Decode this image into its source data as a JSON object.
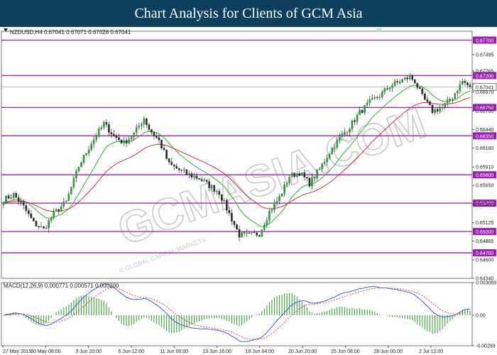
{
  "banner": {
    "title": "Chart Analysis for Clients of GCM Asia"
  },
  "watermark": {
    "text": "GCMASIA.COM",
    "subtext": "© GLOBAL CAPITAL MARKETS"
  },
  "colors": {
    "banner": "#0d3f5f",
    "bull": "#2a9a3a",
    "bear": "#2a2a2a",
    "level": "#9b1fb3",
    "ma_fast": "#22a322",
    "ma_slow": "#d01e2e",
    "macd_line": "#2a4ed8",
    "macd_signal": "#e03030",
    "histogram": "#3ca23c",
    "current_price": "#222222"
  },
  "chart_data": [
    {
      "type": "candlestick",
      "header": "NZDUSD,H4  0.67041 0.67071 0.67028 0.67041",
      "symbol": "NZDUSD",
      "timeframe": "H4",
      "ohlc": {
        "open": 0.67041,
        "high": 0.67071,
        "low": 0.67028,
        "close": 0.67041
      },
      "ylim": [
        0.6434,
        0.67825
      ],
      "y_ticks": [
        0.67265,
        0.67495,
        0.6697,
        0.667,
        0.6644,
        0.6618,
        0.6591,
        0.6565,
        0.6538,
        0.65125,
        0.64865,
        0.646,
        0.6434
      ],
      "x_ticks": [
        "27 May 2019",
        "30 May 08:00",
        "3 Jun 20:00",
        "6 Jun 12:00",
        "11 Jun 00:00",
        "13 Jun 16:00",
        "18 Jun 04:00",
        "20 Jun 20:00",
        "25 Jun 08:00",
        "28 Jun 00:00",
        "2 Jul 12:00"
      ],
      "levels": [
        0.677,
        0.672,
        0.6675,
        0.6635,
        0.658,
        0.654,
        0.65,
        0.647
      ],
      "level_labels": [
        "0.67700",
        "0.67200",
        "0.66750",
        "0.66350",
        "0.65800",
        "0.65400",
        "0.65000",
        "0.64700"
      ],
      "current_price": 0.67041,
      "current_price_label": "0.67041",
      "anchors": [
        [
          0,
          0.6545
        ],
        [
          4,
          0.6552
        ],
        [
          8,
          0.6535
        ],
        [
          12,
          0.6512
        ],
        [
          16,
          0.6503
        ],
        [
          20,
          0.6525
        ],
        [
          25,
          0.6542
        ],
        [
          30,
          0.6592
        ],
        [
          35,
          0.6625
        ],
        [
          40,
          0.6652
        ],
        [
          44,
          0.6635
        ],
        [
          48,
          0.6625
        ],
        [
          52,
          0.6638
        ],
        [
          56,
          0.666
        ],
        [
          58,
          0.6645
        ],
        [
          62,
          0.6628
        ],
        [
          66,
          0.6595
        ],
        [
          70,
          0.6587
        ],
        [
          74,
          0.658
        ],
        [
          78,
          0.6575
        ],
        [
          82,
          0.6565
        ],
        [
          86,
          0.6555
        ],
        [
          90,
          0.6525
        ],
        [
          94,
          0.6495
        ],
        [
          98,
          0.6495
        ],
        [
          102,
          0.6497
        ],
        [
          106,
          0.6528
        ],
        [
          110,
          0.6548
        ],
        [
          114,
          0.6578
        ],
        [
          118,
          0.6583
        ],
        [
          122,
          0.6568
        ],
        [
          126,
          0.6588
        ],
        [
          130,
          0.6612
        ],
        [
          134,
          0.6632
        ],
        [
          138,
          0.6648
        ],
        [
          142,
          0.6668
        ],
        [
          146,
          0.6682
        ],
        [
          150,
          0.6692
        ],
        [
          154,
          0.6705
        ],
        [
          158,
          0.6712
        ],
        [
          162,
          0.6718
        ],
        [
          164,
          0.6712
        ],
        [
          167,
          0.669
        ],
        [
          171,
          0.667
        ],
        [
          175,
          0.6675
        ],
        [
          179,
          0.669
        ],
        [
          183,
          0.6712
        ],
        [
          186,
          0.6704
        ]
      ]
    },
    {
      "type": "macd",
      "label": "MACD(12,26,9)  0.000771 0.000571 0.000200",
      "params": [
        12,
        26,
        9
      ],
      "values": {
        "macd": 0.000771,
        "signal": 0.000571,
        "histogram": 0.0002
      },
      "ylim": [
        -0.00289,
        0.00309
      ],
      "y_ticks": [
        0.003089,
        0.0,
        -0.00289
      ],
      "y_tick_labels": [
        "0.003089",
        "0.00",
        "-0.00289"
      ]
    }
  ]
}
